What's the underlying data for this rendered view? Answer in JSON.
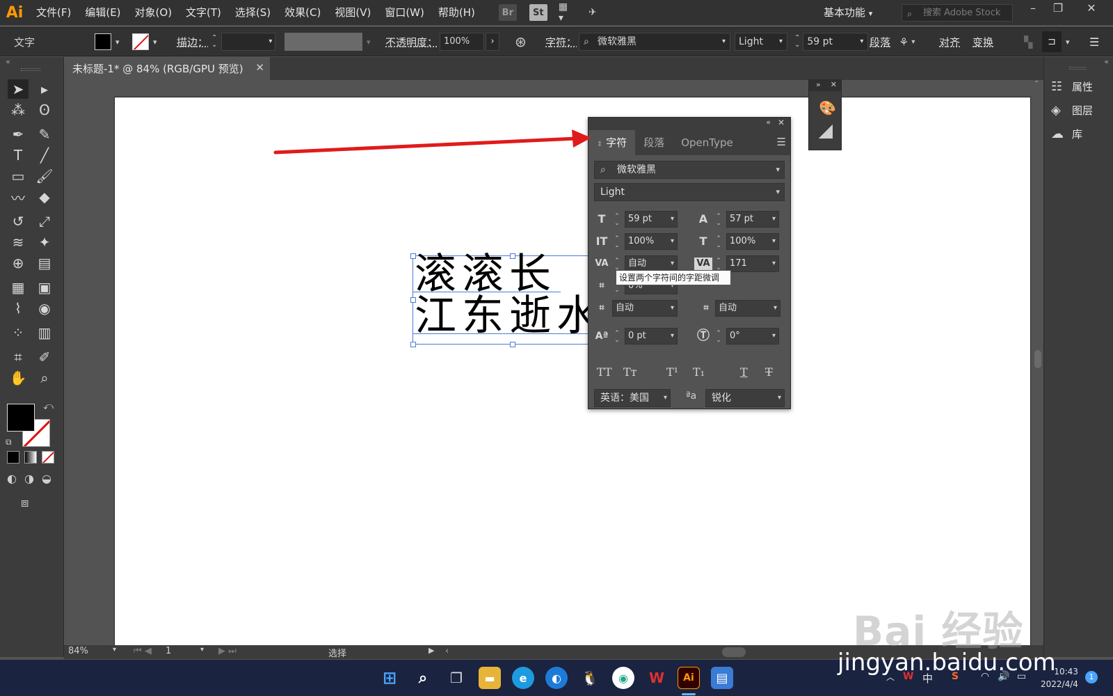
{
  "app": {
    "logo": "Ai",
    "menus": [
      "文件(F)",
      "编辑(E)",
      "对象(O)",
      "文字(T)",
      "选择(S)",
      "效果(C)",
      "视图(V)",
      "窗口(W)",
      "帮助(H)"
    ],
    "bridge_label": "Br",
    "stock_label": "St",
    "workspace": "基本功能",
    "stock_search_placeholder": "搜索 Adobe Stock"
  },
  "control_bar": {
    "context_label": "文字",
    "stroke_label": "描边：",
    "opacity_label": "不透明度：",
    "opacity_value": "100%",
    "character_label": "字符：",
    "font_family": "微软雅黑",
    "font_style": "Light",
    "font_size": "59 pt",
    "paragraph_label": "段落",
    "align_label": "对齐",
    "transform_label": "变换"
  },
  "document": {
    "tab_title": "未标题-1* @ 84% (RGB/GPU 预览)",
    "text_lines": [
      "滚滚长",
      "江东逝水"
    ]
  },
  "character_panel": {
    "tabs": [
      "字符",
      "段落",
      "OpenType"
    ],
    "font_family": "微软雅黑",
    "font_style": "Light",
    "font_size": "59 pt",
    "leading": "57 pt",
    "vertical_scale": "100%",
    "horizontal_scale": "100%",
    "kerning": "自动",
    "tracking": "171",
    "tsume": "0%",
    "aki_left": "自动",
    "aki_right": "自动",
    "baseline_shift": "0 pt",
    "rotation": "0°",
    "language": "英语：美国",
    "antialias": "锐化",
    "tooltip": "设置两个字符间的字距微调"
  },
  "right_dock": {
    "items": [
      "属性",
      "图层",
      "库"
    ]
  },
  "status_bar": {
    "zoom": "84%",
    "page": "1",
    "tool_status": "选择"
  },
  "taskbar": {
    "ime": "中",
    "time": "10:43",
    "date": "2022/4/4",
    "notification_count": "1"
  },
  "watermark": {
    "brand": "Bai 经验",
    "url": "jingyan.baidu.com"
  },
  "colors": {
    "accent_selection": "#4a7bd4",
    "arrow": "#e01b1b",
    "ai_orange": "#ff9a00"
  }
}
